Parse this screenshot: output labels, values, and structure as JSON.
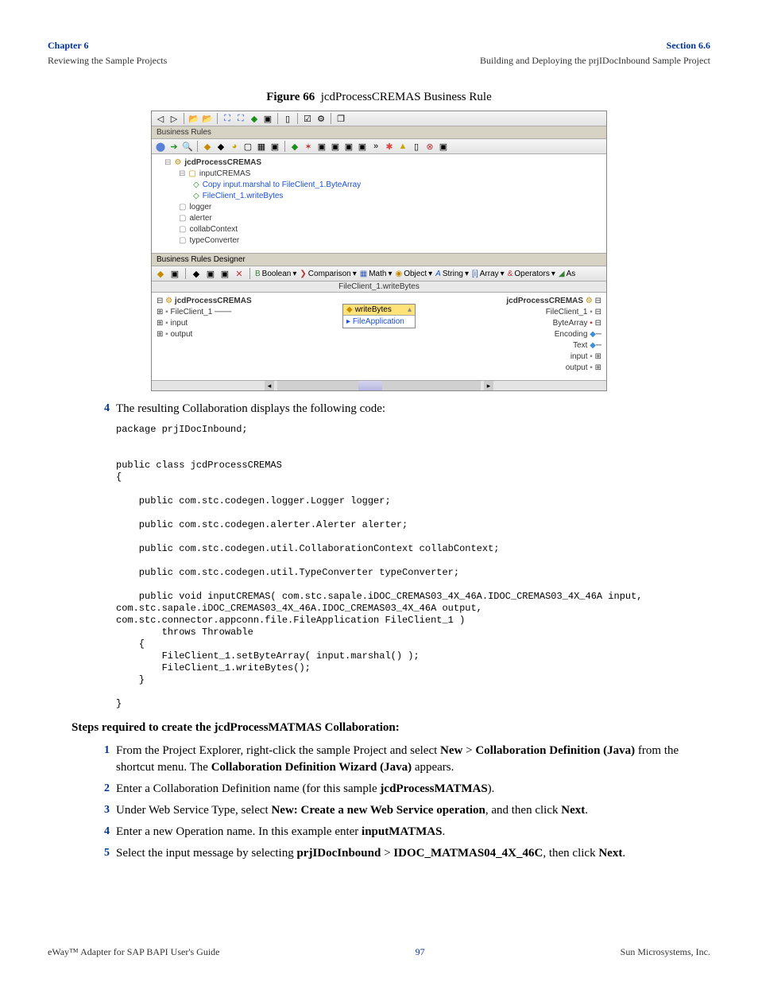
{
  "header": {
    "left_title": "Chapter 6",
    "left_sub": "Reviewing the Sample Projects",
    "right_title": "Section 6.6",
    "right_sub": "Building and Deploying the prjIDocInbound Sample Project"
  },
  "figure": {
    "label": "Figure 66",
    "title": "jcdProcessCREMAS Business Rule"
  },
  "screenshot": {
    "panel1": "Business Rules",
    "tree": {
      "root": "jcdProcessCREMAS",
      "n1": "inputCREMAS",
      "n2": "Copy input.marshal to FileClient_1.ByteArray",
      "n3": "FileClient_1.writeBytes",
      "n4": "logger",
      "n5": "alerter",
      "n6": "collabContext",
      "n7": "typeConverter"
    },
    "designer_label": "Business Rules Designer",
    "menus": {
      "bool": "Boolean",
      "comp": "Comparison",
      "math": "Math",
      "obj": "Object",
      "str": "String",
      "arr": "Array",
      "ops": "Operators",
      "as": "As"
    },
    "canvas_title": "FileClient_1.writeBytes",
    "left_items": [
      "jcdProcessCREMAS",
      "FileClient_1",
      "input",
      "output"
    ],
    "right_items": [
      "jcdProcessCREMAS",
      "FileClient_1",
      "ByteArray",
      "Encoding",
      "Text",
      "input",
      "output"
    ],
    "node": {
      "hdr": "writeBytes",
      "body": "FileApplication"
    }
  },
  "step4_intro": "The resulting Collaboration displays the following code:",
  "code": "package prjIDocInbound;\n\n\npublic class jcdProcessCREMAS\n{\n\n    public com.stc.codegen.logger.Logger logger;\n\n    public com.stc.codegen.alerter.Alerter alerter;\n\n    public com.stc.codegen.util.CollaborationContext collabContext;\n\n    public com.stc.codegen.util.TypeConverter typeConverter;\n\n    public void inputCREMAS( com.stc.sapale.iDOC_CREMAS03_4X_46A.IDOC_CREMAS03_4X_46A input,\ncom.stc.sapale.iDOC_CREMAS03_4X_46A.IDOC_CREMAS03_4X_46A output,\ncom.stc.connector.appconn.file.FileApplication FileClient_1 )\n        throws Throwable\n    {\n        FileClient_1.setByteArray( input.marshal() );\n        FileClient_1.writeBytes();\n    }\n\n}",
  "subheading": "Steps required to create the jcdProcessMATMAS Collaboration:",
  "steps": {
    "s1a": "From the Project Explorer, right-click the sample Project and select ",
    "s1b": "New",
    "s1c": " > ",
    "s1d": "Collaboration Definition (Java)",
    "s1e": " from the shortcut menu. The ",
    "s1f": "Collaboration Definition Wizard (Java)",
    "s1g": " appears.",
    "s2a": "Enter a Collaboration Definition name (for this sample ",
    "s2b": "jcdProcessMATMAS",
    "s2c": ").",
    "s3a": "Under Web Service Type, select ",
    "s3b": "New: Create a new Web Service operation",
    "s3c": ", and then click ",
    "s3d": "Next",
    "s3e": ".",
    "s4a": "Enter a new Operation name. In this example enter ",
    "s4b": "inputMATMAS",
    "s4c": ".",
    "s5a": "Select the input message by selecting ",
    "s5b": "prjIDocInbound",
    "s5c": " > ",
    "s5d": "IDOC_MATMAS04_4X_46C",
    "s5e": ", then click ",
    "s5f": "Next",
    "s5g": "."
  },
  "footer": {
    "left": "eWay™ Adapter for SAP BAPI User's Guide",
    "center": "97",
    "right": "Sun Microsystems, Inc."
  }
}
